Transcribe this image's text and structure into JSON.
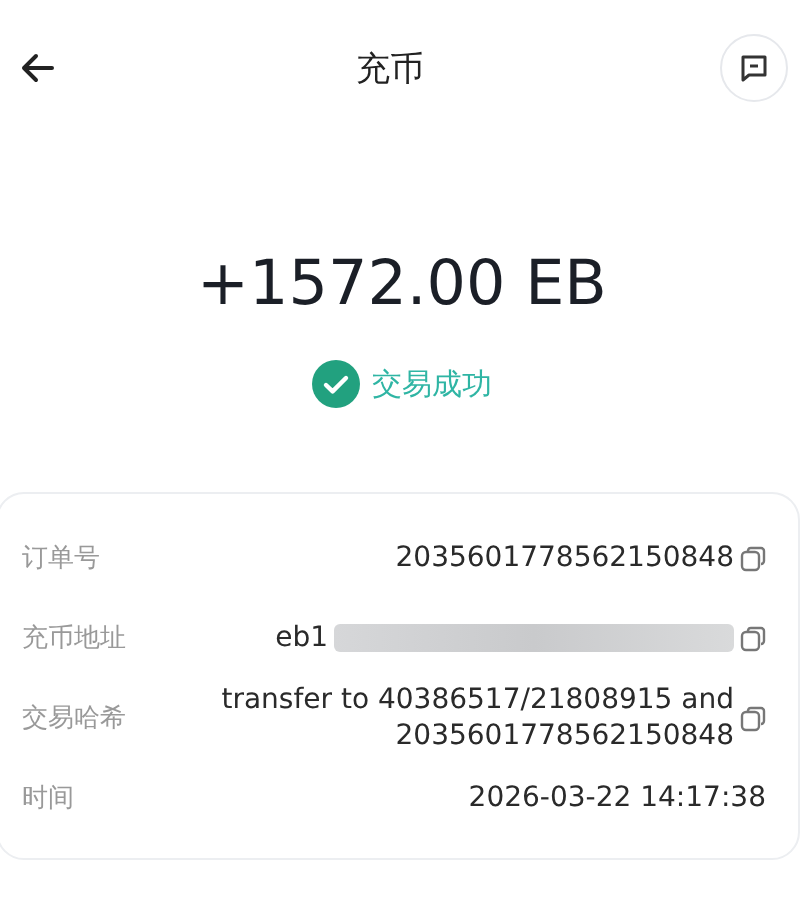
{
  "header": {
    "title": "充币"
  },
  "amount": "+1572.00 EB",
  "status": {
    "text": "交易成功",
    "success": true
  },
  "details": [
    {
      "label": "订单号",
      "value": "2035601778562150848",
      "copyable": true,
      "redacted": false
    },
    {
      "label": "充币地址",
      "value": "eb1",
      "copyable": true,
      "redacted": true
    },
    {
      "label": "交易哈希",
      "value": "transfer to 40386517/21808915 and 2035601778562150848",
      "copyable": true,
      "redacted": false
    },
    {
      "label": "时间",
      "value": "2026-03-22 14:17:38",
      "copyable": false,
      "redacted": false
    }
  ]
}
